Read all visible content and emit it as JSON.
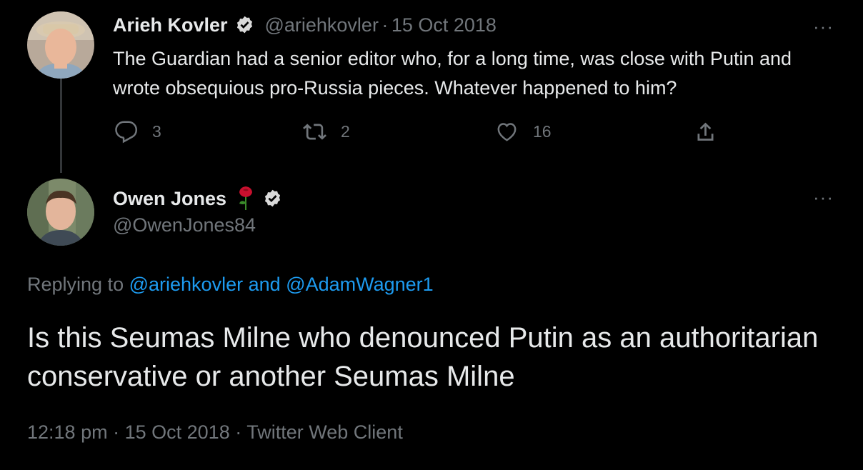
{
  "tweet1": {
    "author_name": "Arieh Kovler",
    "handle": "@ariehkovler",
    "separator": "·",
    "date": "15 Oct 2018",
    "text": "The Guardian had a senior editor who, for a long time, was close with Putin and wrote obsequious pro-Russia pieces. Whatever happened to him?",
    "reply_count": "3",
    "retweet_count": "2",
    "like_count": "16",
    "more_label": "···"
  },
  "tweet2": {
    "author_name": "Owen Jones",
    "handle": "@OwenJones84",
    "more_label": "···",
    "replying_prefix": "Replying to",
    "reply_to_1": "@ariehkovler",
    "reply_and": "and",
    "reply_to_2": "@AdamWagner1",
    "text": "Is this Seumas Milne who denounced Putin as an authoritarian conservative or another Seumas Milne",
    "time": "12:18 pm",
    "meta_sep1": "·",
    "date": "15 Oct 2018",
    "meta_sep2": "·",
    "client": "Twitter Web Client"
  },
  "icons": {
    "verified": "verified-badge-icon",
    "reply": "reply-icon",
    "retweet": "retweet-icon",
    "like": "like-icon",
    "share": "share-icon",
    "rose": "rose-emoji-icon"
  },
  "colors": {
    "background": "#000000",
    "text": "#e7e9ea",
    "muted": "#71767b",
    "link": "#1d9bf0"
  }
}
